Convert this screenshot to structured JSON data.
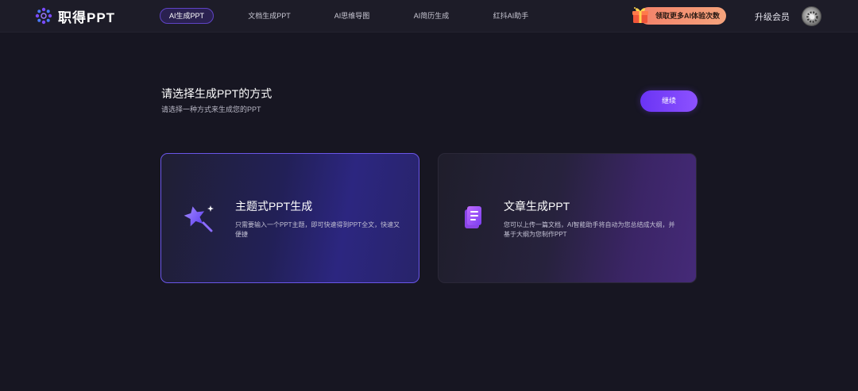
{
  "brand": {
    "name": "职得PPT"
  },
  "nav": {
    "tabs": [
      {
        "label": "AI生成PPT",
        "active": true
      },
      {
        "label": "文档生成PPT",
        "active": false
      },
      {
        "label": "AI思维导图",
        "active": false
      },
      {
        "label": "AI简历生成",
        "active": false
      },
      {
        "label": "红抖AI助手",
        "active": false
      }
    ]
  },
  "header": {
    "promo_label": "领取更多AI体验次数",
    "upgrade_label": "升级会员"
  },
  "main": {
    "title": "请选择生成PPT的方式",
    "subtitle": "请选择一种方式来生成您的PPT",
    "continue_label": "继续",
    "options": [
      {
        "title": "主题式PPT生成",
        "description": "只需要输入一个PPT主题，即可快速得到PPT全文，快速又便捷",
        "icon": "magic-wand-icon",
        "selected": true
      },
      {
        "title": "文章生成PPT",
        "description": "您可以上传一篇文档，AI智能助手将自动为您总结成大纲，并基于大纲为您制作PPT",
        "icon": "document-icon",
        "selected": false
      }
    ]
  },
  "colors": {
    "background": "#171622",
    "topbar": "#1d1c28",
    "accent": "#6a34f4",
    "selected_border": "#6a56e8",
    "promo": "#f3826a"
  }
}
